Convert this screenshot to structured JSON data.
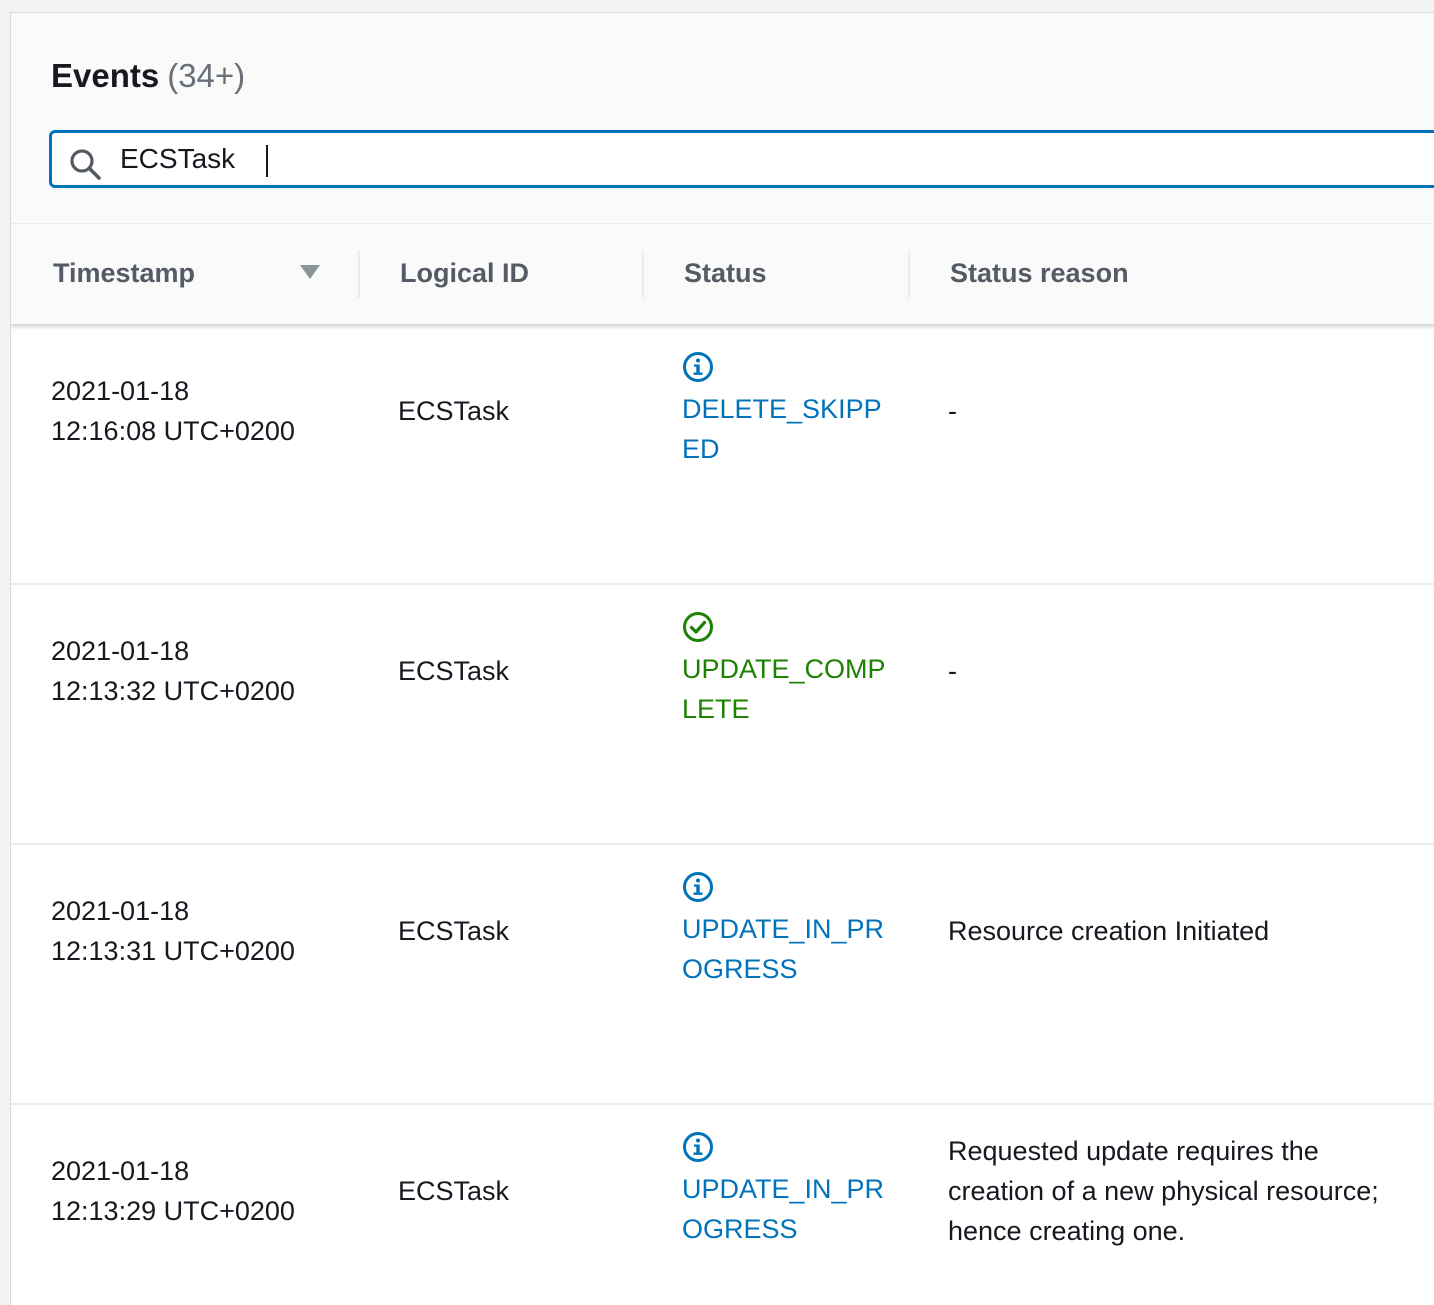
{
  "panel": {
    "title": "Events",
    "count": "(34+)"
  },
  "search": {
    "value": "ECSTask",
    "icon": "search-icon"
  },
  "table": {
    "columns": [
      "Timestamp",
      "Logical ID",
      "Status",
      "Status reason"
    ],
    "sort": {
      "column": "Timestamp",
      "direction": "descending",
      "icon": "caret-down-icon"
    },
    "rows": [
      {
        "timestamp_date": "2021-01-18",
        "timestamp_time": "12:16:08 UTC+0200",
        "logical_id": "ECSTask",
        "status": "DELETE_SKIPPED",
        "status_icon": "info-icon",
        "status_reason": "-"
      },
      {
        "timestamp_date": "2021-01-18",
        "timestamp_time": "12:13:32 UTC+0200",
        "logical_id": "ECSTask",
        "status": "UPDATE_COMPLETE",
        "status_icon": "success-check-icon",
        "status_reason": "-"
      },
      {
        "timestamp_date": "2021-01-18",
        "timestamp_time": "12:13:31 UTC+0200",
        "logical_id": "ECSTask",
        "status": "UPDATE_IN_PROGRESS",
        "status_icon": "info-icon",
        "status_reason": "Resource creation Initiated"
      },
      {
        "timestamp_date": "2021-01-18",
        "timestamp_time": "12:13:29 UTC+0200",
        "logical_id": "ECSTask",
        "status": "UPDATE_IN_PROGRESS",
        "status_icon": "info-icon",
        "status_reason": "Requested update requires the creation of a new physical resource; hence creating one."
      }
    ]
  },
  "colors": {
    "accent": "#0073bb",
    "info": "#0073bb",
    "success": "#1d8102",
    "header_text": "#545b64",
    "count_text": "#687078"
  }
}
